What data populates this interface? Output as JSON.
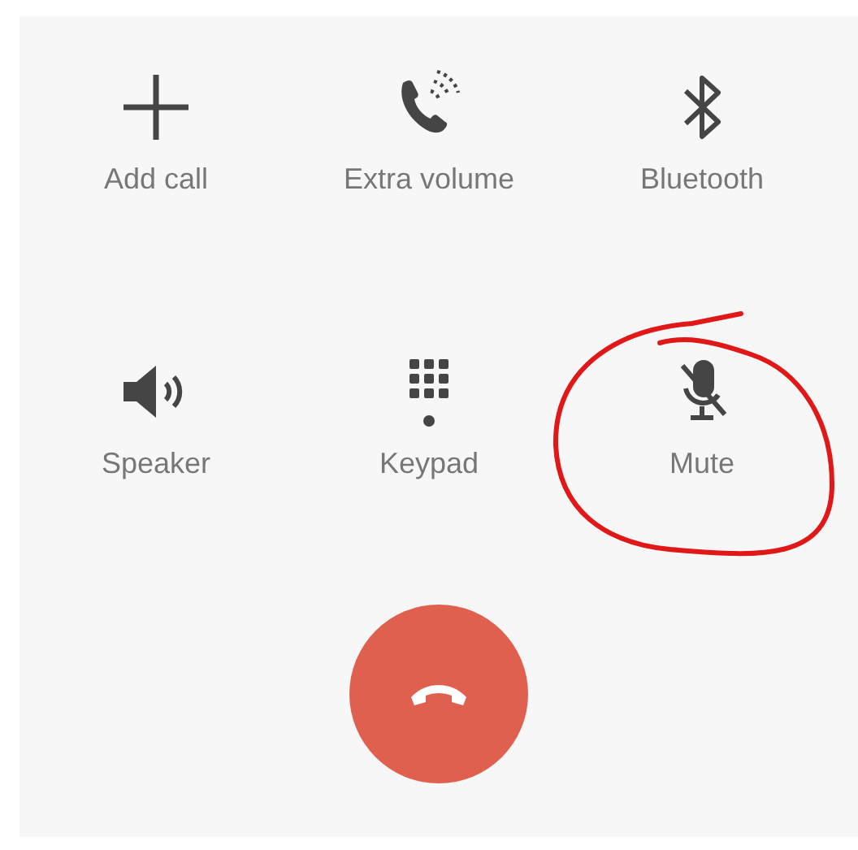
{
  "buttons": [
    {
      "kind": "add",
      "label": "Add call",
      "highlighted": false
    },
    {
      "kind": "volume",
      "label": "Extra volume",
      "highlighted": false
    },
    {
      "kind": "bluetooth",
      "label": "Bluetooth",
      "highlighted": false
    },
    {
      "kind": "speaker",
      "label": "Speaker",
      "highlighted": false
    },
    {
      "kind": "keypad",
      "label": "Keypad",
      "highlighted": false
    },
    {
      "kind": "mute",
      "label": "Mute",
      "highlighted": true
    }
  ],
  "end_call": {
    "kind": "hangup"
  }
}
